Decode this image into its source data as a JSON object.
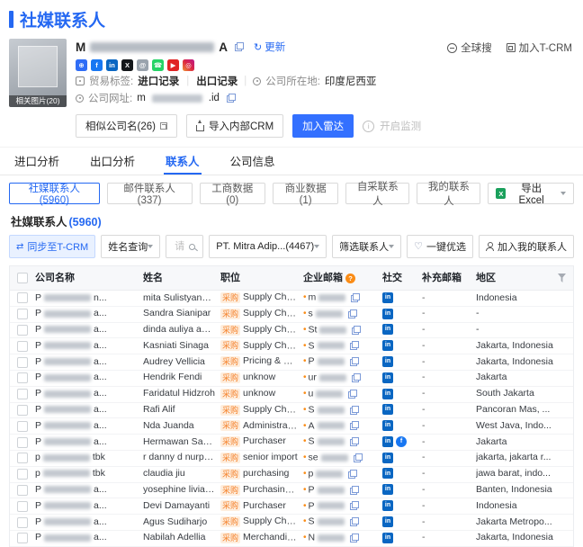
{
  "page": {
    "title": "社媒联系人"
  },
  "header": {
    "company_prefix": "M",
    "company_suffix": "A",
    "refresh_label": "更新",
    "thumb_label": "相关图片(20)",
    "trade_tag_label": "贸易标签:",
    "trade_tags": [
      "进口记录",
      "出口记录"
    ],
    "location_label": "公司所在地:",
    "location_value": "印度尼西亚",
    "website_label": "公司网址:",
    "website_prefix": "m",
    "website_suffix": ".id",
    "global_search_label": "全球搜",
    "add_tcrm_label": "加入T-CRM",
    "social_icons": [
      {
        "name": "website-icon",
        "glyph": "⊕",
        "color": "#2f6df6"
      },
      {
        "name": "facebook-icon",
        "glyph": "f",
        "color": "#1877f2"
      },
      {
        "name": "linkedin-icon",
        "glyph": "in",
        "color": "#0a66c2"
      },
      {
        "name": "x-icon",
        "glyph": "X",
        "color": "#14171a"
      },
      {
        "name": "email-icon",
        "glyph": "@",
        "color": "#9aa3ad"
      },
      {
        "name": "whatsapp-icon",
        "glyph": "☎",
        "color": "#25d366"
      },
      {
        "name": "youtube-icon",
        "glyph": "▶",
        "color": "#e02424"
      },
      {
        "name": "instagram-icon",
        "glyph": "◎",
        "color": "linear-gradient(45deg,#f09433,#dc2743,#bc1888)"
      }
    ]
  },
  "actions": {
    "similar_company": "相似公司名(26)",
    "import_crm": "导入内部CRM",
    "add_radar": "加入雷达",
    "monitor": "开启监测"
  },
  "tabs": [
    {
      "label": "进口分析",
      "active": false
    },
    {
      "label": "出口分析",
      "active": false
    },
    {
      "label": "联系人",
      "active": true
    },
    {
      "label": "公司信息",
      "active": false
    }
  ],
  "subtabs": [
    {
      "label": "社媒联系人(5960)",
      "active": true
    },
    {
      "label": "邮件联系人(337)",
      "active": false
    },
    {
      "label": "工商数据(0)",
      "active": false
    },
    {
      "label": "商业数据(1)",
      "active": false
    },
    {
      "label": "自采联系人",
      "active": false
    },
    {
      "label": "我的联系人",
      "active": false
    }
  ],
  "export_label": "导出 Excel",
  "section": {
    "title": "社媒联系人",
    "count": "(5960)"
  },
  "toolbar": {
    "sync_label": "同步至T-CRM",
    "name_query_label": "姓名查询",
    "name_placeholder": "请输入姓名",
    "company_filter": "PT. Mitra Adip...(4467)",
    "contact_filter": "筛选联系人",
    "quick_select": "一键优选",
    "add_my_contacts": "加入我的联系人"
  },
  "table": {
    "position_tag": "采购",
    "headers": {
      "company": "公司名称",
      "name": "姓名",
      "position": "职位",
      "email": "企业邮箱",
      "social": "社交",
      "extra_email": "补充邮箱",
      "region": "地区"
    },
    "rows": [
      {
        "company_prefix": "P",
        "company_suffix": "n...",
        "name": "mita Sulistyandari",
        "position": "Supply Chain Assistant Man...",
        "email_prefix": "m",
        "socials": [
          "linkedin"
        ],
        "extra_email": "-",
        "region": "Indonesia"
      },
      {
        "company_prefix": "P",
        "company_suffix": "a...",
        "name": "Sandra Sianipar",
        "position": "Supply Chain Officer",
        "email_prefix": "s",
        "socials": [
          "linkedin"
        ],
        "extra_email": "-",
        "region": "-"
      },
      {
        "company_prefix": "P",
        "company_suffix": "a...",
        "name": "dinda auliya adha",
        "position": "Supply Chain Officer",
        "email_prefix": "St",
        "socials": [
          "linkedin"
        ],
        "extra_email": "-",
        "region": "-"
      },
      {
        "company_prefix": "P",
        "company_suffix": "a...",
        "name": "Kasniati Sinaga",
        "position": "Supply Chain Management",
        "email_prefix": "S",
        "socials": [
          "linkedin"
        ],
        "extra_email": "-",
        "region": "Jakarta, Indonesia"
      },
      {
        "company_prefix": "P",
        "company_suffix": "a...",
        "name": "Audrey Vellicia",
        "position": "Pricing & Promotion Execut...",
        "email_prefix": "P",
        "socials": [
          "linkedin"
        ],
        "extra_email": "-",
        "region": "Jakarta, Indonesia"
      },
      {
        "company_prefix": "P",
        "company_suffix": "a...",
        "name": "Hendrik Fendi",
        "position": "unknow",
        "email_prefix": "ur",
        "socials": [
          "linkedin"
        ],
        "extra_email": "-",
        "region": "Jakarta"
      },
      {
        "company_prefix": "P",
        "company_suffix": "a...",
        "name": "Faridatul Hidzroh",
        "position": "unknow",
        "email_prefix": "u",
        "socials": [
          "linkedin"
        ],
        "extra_email": "-",
        "region": "South Jakarta"
      },
      {
        "company_prefix": "P",
        "company_suffix": "a...",
        "name": "Rafi Alif",
        "position": "Supply Chain Management ...",
        "email_prefix": "S",
        "socials": [
          "linkedin"
        ],
        "extra_email": "-",
        "region": "Pancoran Mas, ..."
      },
      {
        "company_prefix": "P",
        "company_suffix": "a...",
        "name": "Nda Juanda",
        "position": "Administrasi Supply Chain (...",
        "email_prefix": "A",
        "socials": [
          "linkedin"
        ],
        "extra_email": "-",
        "region": "West Java, Indo..."
      },
      {
        "company_prefix": "P",
        "company_suffix": "a...",
        "name": "Hermawan Sapu...",
        "position": "Purchaser",
        "email_prefix": "S",
        "socials": [
          "linkedin",
          "facebook"
        ],
        "extra_email": "-",
        "region": "Jakarta"
      },
      {
        "company_prefix": "p",
        "company_suffix": "tbk",
        "name": "r danny d nurpat...",
        "position": "senior import",
        "email_prefix": "se",
        "socials": [
          "linkedin"
        ],
        "extra_email": "-",
        "region": "jakarta, jakarta r..."
      },
      {
        "company_prefix": "p",
        "company_suffix": "tbk",
        "name": "claudia jiu",
        "position": "purchasing",
        "email_prefix": "p",
        "socials": [
          "linkedin"
        ],
        "extra_email": "-",
        "region": "jawa barat, indo..."
      },
      {
        "company_prefix": "P",
        "company_suffix": "a...",
        "name": "yosephine liviane",
        "position": "Purchasing analysis",
        "email_prefix": "P",
        "socials": [
          "linkedin"
        ],
        "extra_email": "-",
        "region": "Banten, Indonesia"
      },
      {
        "company_prefix": "P",
        "company_suffix": "a...",
        "name": "Devi Damayanti",
        "position": "Purchaser",
        "email_prefix": "P",
        "socials": [
          "linkedin"
        ],
        "extra_email": "-",
        "region": "Indonesia"
      },
      {
        "company_prefix": "P",
        "company_suffix": "a...",
        "name": "Agus Sudiharjo",
        "position": "Supply Chain Governance In...",
        "email_prefix": "S",
        "socials": [
          "linkedin"
        ],
        "extra_email": "-",
        "region": "Jakarta Metropo..."
      },
      {
        "company_prefix": "P",
        "company_suffix": "a...",
        "name": "Nabilah Adellia",
        "position": "Merchandiser",
        "email_prefix": "N",
        "socials": [
          "linkedin"
        ],
        "extra_email": "-",
        "region": "Jakarta, Indonesia"
      }
    ]
  }
}
